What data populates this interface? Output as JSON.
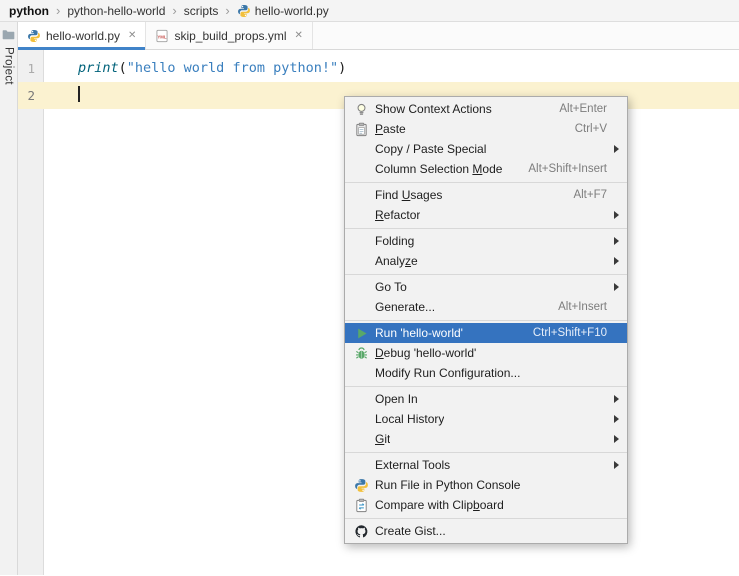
{
  "colors": {
    "accent_blue": "#4083C9",
    "menu_selection": "#3573BF",
    "caret_line_yellow": "#FBF2D0",
    "string_blue": "#3A7FBE",
    "builtin_teal": "#00627A",
    "run_green": "#59A869",
    "yaml_red": "#C75450"
  },
  "breadcrumb": {
    "separator": "›",
    "items": [
      {
        "label": "python",
        "bold": true
      },
      {
        "label": "python-hello-world"
      },
      {
        "label": "scripts"
      },
      {
        "label": "hello-world.py",
        "icon": "python-file-icon"
      }
    ]
  },
  "sidebar": {
    "project_label": "Project"
  },
  "tabs": {
    "close_glyph": "✕",
    "items": [
      {
        "label": "hello-world.py",
        "icon": "python-file-icon",
        "active": true
      },
      {
        "label": "skip_build_props.yml",
        "icon": "yaml-file-icon",
        "active": false
      }
    ]
  },
  "editor": {
    "lines": [
      {
        "number": "1",
        "tokens": [
          {
            "t": "print",
            "c": "builtin"
          },
          {
            "t": "(",
            "c": "plain"
          },
          {
            "t": "\"hello world from python!\"",
            "c": "string"
          },
          {
            "t": ")",
            "c": "plain"
          }
        ]
      },
      {
        "number": "2",
        "tokens": [],
        "current": true
      }
    ]
  },
  "menu": {
    "groups": [
      [
        {
          "label": "Show Context Actions",
          "shortcut": "Alt+Enter",
          "icon": "bulb-icon"
        },
        {
          "label": "Paste",
          "shortcut": "Ctrl+V",
          "icon": "paste-icon",
          "mnemonic": "P"
        },
        {
          "label": "Copy / Paste Special",
          "submenu": true
        },
        {
          "label": "Column Selection Mode",
          "shortcut": "Alt+Shift+Insert",
          "mnemonic": "M"
        }
      ],
      [
        {
          "label": "Find Usages",
          "shortcut": "Alt+F7",
          "mnemonic": "U"
        },
        {
          "label": "Refactor",
          "submenu": true,
          "mnemonic": "R"
        }
      ],
      [
        {
          "label": "Folding",
          "submenu": true
        },
        {
          "label": "Analyze",
          "submenu": true,
          "mnemonic": "z"
        }
      ],
      [
        {
          "label": "Go To",
          "submenu": true
        },
        {
          "label": "Generate...",
          "shortcut": "Alt+Insert"
        }
      ],
      [
        {
          "label": "Run 'hello-world'",
          "shortcut": "Ctrl+Shift+F10",
          "icon": "run-icon",
          "selected": true
        },
        {
          "label": "Debug 'hello-world'",
          "icon": "debug-icon",
          "mnemonic": "D"
        },
        {
          "label": "Modify Run Configuration..."
        }
      ],
      [
        {
          "label": "Open In",
          "submenu": true
        },
        {
          "label": "Local History",
          "submenu": true
        },
        {
          "label": "Git",
          "submenu": true,
          "mnemonic": "G"
        }
      ],
      [
        {
          "label": "External Tools",
          "submenu": true
        },
        {
          "label": "Run File in Python Console",
          "icon": "python-console-icon"
        },
        {
          "label": "Compare with Clipboard",
          "icon": "compare-icon",
          "mnemonic": "b"
        }
      ],
      [
        {
          "label": "Create Gist...",
          "icon": "github-icon"
        }
      ]
    ]
  }
}
